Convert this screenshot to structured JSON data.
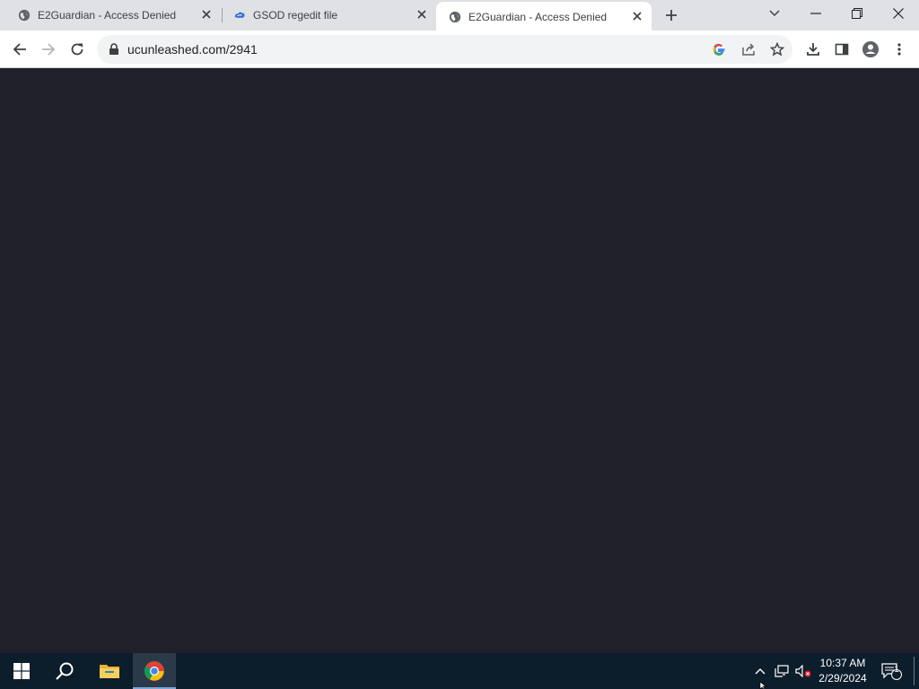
{
  "browser": {
    "tabs": [
      {
        "title": "E2Guardian - Access Denied",
        "favicon": "globe-icon",
        "active": false
      },
      {
        "title": "GSOD regedit file",
        "favicon": "cloud-icon",
        "active": false
      },
      {
        "title": "E2Guardian - Access Denied",
        "favicon": "globe-icon",
        "active": true
      }
    ],
    "address_bar": {
      "url": "ucunleashed.com/2941"
    }
  },
  "taskbar": {
    "time": "10:37 AM",
    "date": "2/29/2024",
    "notification_count": "1"
  },
  "colors": {
    "page_background": "#1f2029",
    "tabstrip": "#dfe1e5",
    "taskbar": "#0c1d2c"
  }
}
